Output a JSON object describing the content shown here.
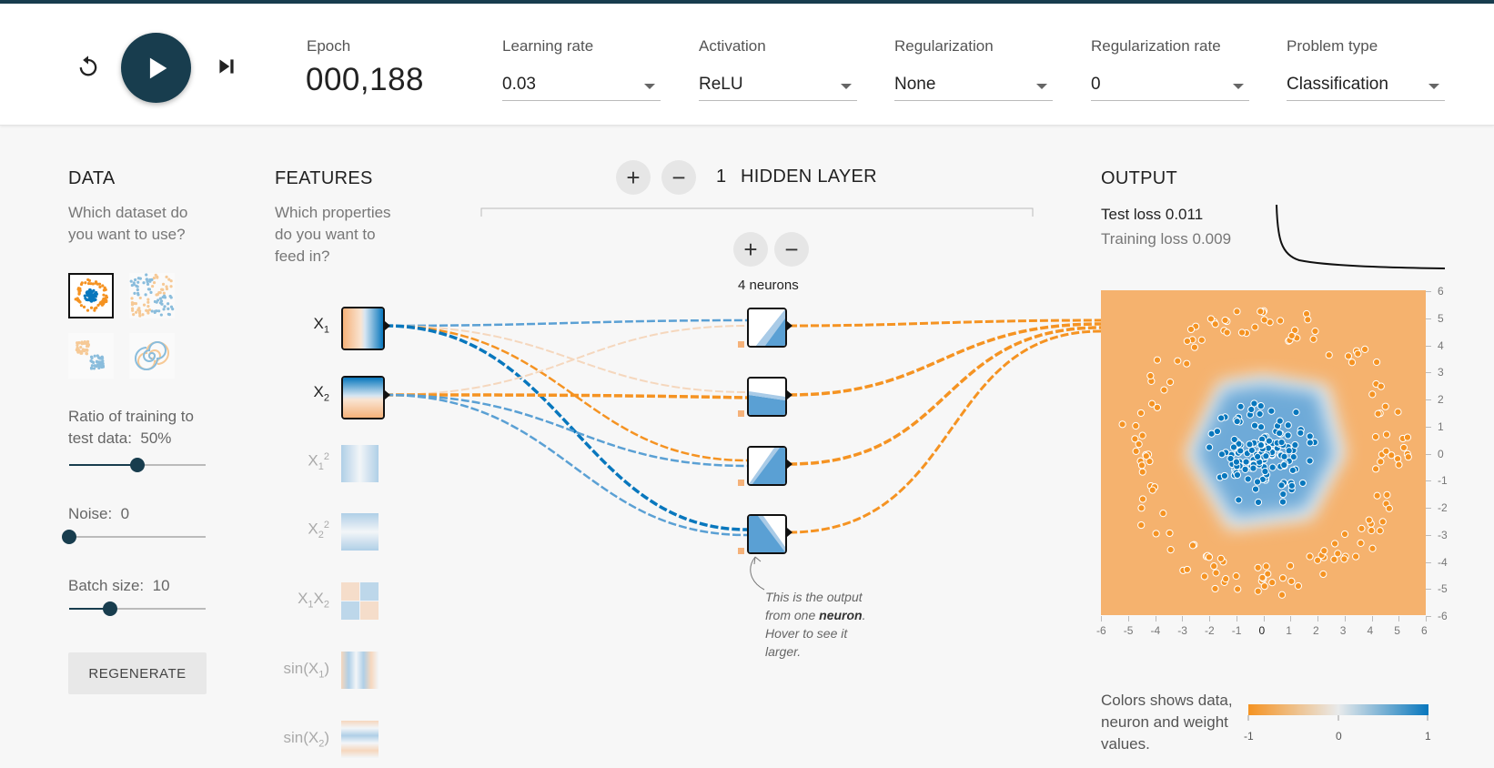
{
  "header": {
    "reset_icon": "reset-icon",
    "play_icon": "play-icon",
    "step_icon": "step-icon",
    "epoch_label": "Epoch",
    "epoch_value": "000,188",
    "learning_rate": {
      "label": "Learning rate",
      "value": "0.03"
    },
    "activation": {
      "label": "Activation",
      "value": "ReLU"
    },
    "regularization": {
      "label": "Regularization",
      "value": "None"
    },
    "regularization_rate": {
      "label": "Regularization rate",
      "value": "0"
    },
    "problem_type": {
      "label": "Problem type",
      "value": "Classification"
    }
  },
  "data_panel": {
    "title": "DATA",
    "subtitle": "Which dataset do you want to use?",
    "datasets": [
      "circle",
      "xor",
      "gaussian",
      "spiral"
    ],
    "selected_dataset": "circle",
    "ratio_label": "Ratio of training to test data:",
    "ratio_value": "50%",
    "ratio_fraction": 0.5,
    "noise_label": "Noise:",
    "noise_value": "0",
    "noise_fraction": 0,
    "batch_label": "Batch size:",
    "batch_value": "10",
    "batch_fraction": 0.3,
    "regenerate_label": "REGENERATE"
  },
  "features_panel": {
    "title": "FEATURES",
    "subtitle": "Which properties do you want to feed in?",
    "features": [
      {
        "name": "X1",
        "active": true
      },
      {
        "name": "X2",
        "active": true
      },
      {
        "name": "X1^2",
        "active": false
      },
      {
        "name": "X2^2",
        "active": false
      },
      {
        "name": "X1X2",
        "active": false
      },
      {
        "name": "sin(X1)",
        "active": false
      },
      {
        "name": "sin(X2)",
        "active": false
      }
    ]
  },
  "network": {
    "add_layer_symbol": "+",
    "remove_layer_symbol": "−",
    "layer_count": "1",
    "layer_label": "HIDDEN LAYER",
    "add_neuron_symbol": "+",
    "remove_neuron_symbol": "−",
    "neurons_label": "4 neurons",
    "note_line1": "This is the output from one ",
    "note_bold": "neuron",
    "note_line2": ". Hover to see it larger."
  },
  "output_panel": {
    "title": "OUTPUT",
    "test_loss_label": "Test loss",
    "test_loss_value": "0.011",
    "training_loss_label": "Training loss",
    "training_loss_value": "0.009",
    "y_ticks": [
      "6",
      "5",
      "4",
      "3",
      "2",
      "1",
      "0",
      "-1",
      "-2",
      "-3",
      "-4",
      "-5",
      "-6"
    ],
    "x_ticks": [
      "-6",
      "-5",
      "-4",
      "-3",
      "-2",
      "-1",
      "0",
      "1",
      "2",
      "3",
      "4",
      "5",
      "6"
    ],
    "legend_text": "Colors shows data, neuron and weight values.",
    "legend_min": "-1",
    "legend_mid": "0",
    "legend_max": "1"
  },
  "colors": {
    "dark": "#183d4e",
    "orange": "#f59322",
    "blue": "#0877bd",
    "light_orange": "#f5b27a",
    "light_blue": "#5aa0d4"
  }
}
